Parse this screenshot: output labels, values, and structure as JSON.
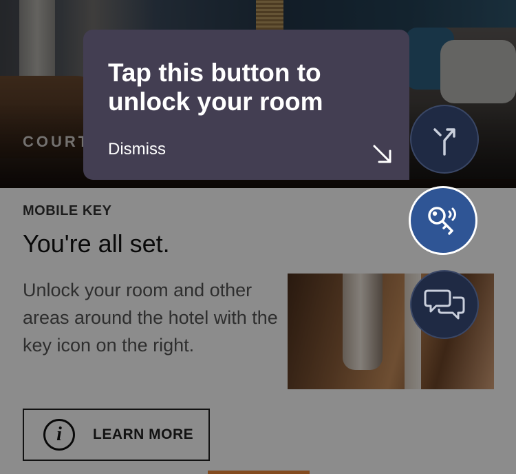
{
  "hero": {
    "brand_text": "COURT"
  },
  "mobile_key": {
    "eyebrow": "MOBILE KEY",
    "headline": "You're all set.",
    "description": "Unlock your room and other areas around the hotel with the key icon on the right.",
    "learn_more_label": "LEARN MORE",
    "info_icon": "info-icon"
  },
  "tooltip": {
    "title": "Tap this button to unlock your room",
    "dismiss_label": "Dismiss",
    "pointer_icon": "arrow-down-right-icon"
  },
  "floating_actions": [
    {
      "icon": "directions-icon"
    },
    {
      "icon": "mobile-key-icon"
    },
    {
      "icon": "chat-icon"
    }
  ],
  "colors": {
    "tooltip_bg": "#433e52",
    "fab_active": "#2f5595",
    "fab_inactive": "#1f2a44",
    "accent_orange": "#f08a3a"
  }
}
